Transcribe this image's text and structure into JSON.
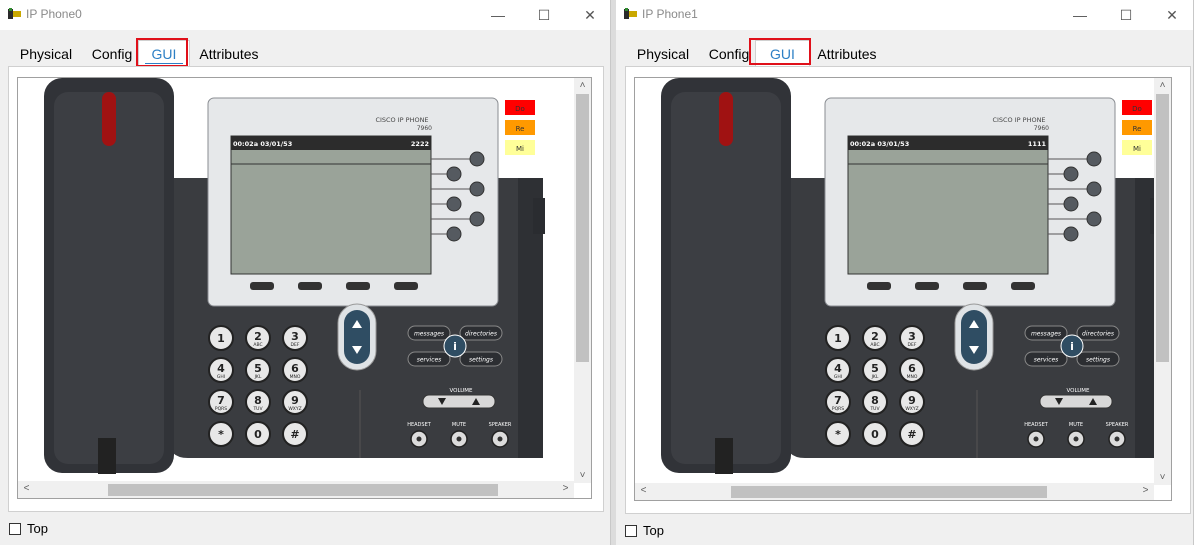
{
  "windows": [
    {
      "title": "IP Phone0",
      "tabs": [
        "Physical",
        "Config",
        "GUI",
        "Attributes"
      ],
      "active_tab": "GUI",
      "phone": {
        "brand": "CISCO IP PHONE",
        "model": "7960",
        "screen_time": "00:02a 03/01/53",
        "screen_number": "2222",
        "status_labels": [
          "Do",
          "Re",
          "Mi"
        ],
        "keys": [
          [
            "1",
            ""
          ],
          [
            "2",
            "ABC"
          ],
          [
            "3",
            "DEF"
          ],
          [
            "4",
            "GHI"
          ],
          [
            "5",
            "JKL"
          ],
          [
            "6",
            "MNO"
          ],
          [
            "7",
            "PQRS"
          ],
          [
            "8",
            "TUV"
          ],
          [
            "9",
            "WXYZ"
          ],
          [
            "*",
            ""
          ],
          [
            "0",
            ""
          ],
          [
            "#",
            ""
          ]
        ],
        "func_buttons": [
          "messages",
          "directories",
          "services",
          "settings"
        ],
        "volume_label": "VOLUME",
        "bottom_labels": [
          "HEADSET",
          "MUTE",
          "SPEAKER"
        ]
      },
      "top_label": "Top"
    },
    {
      "title": "IP Phone1",
      "tabs": [
        "Physical",
        "Config",
        "GUI",
        "Attributes"
      ],
      "active_tab": "GUI",
      "phone": {
        "brand": "CISCO IP PHONE",
        "model": "7960",
        "screen_time": "00:02a 03/01/53",
        "screen_number": "1111",
        "status_labels": [
          "Do",
          "Re",
          "Mi"
        ],
        "keys": [
          [
            "1",
            ""
          ],
          [
            "2",
            "ABC"
          ],
          [
            "3",
            "DEF"
          ],
          [
            "4",
            "GHI"
          ],
          [
            "5",
            "JKL"
          ],
          [
            "6",
            "MNO"
          ],
          [
            "7",
            "PQRS"
          ],
          [
            "8",
            "TUV"
          ],
          [
            "9",
            "WXYZ"
          ],
          [
            "*",
            ""
          ],
          [
            "0",
            ""
          ],
          [
            "#",
            ""
          ]
        ],
        "func_buttons": [
          "messages",
          "directories",
          "services",
          "settings"
        ],
        "volume_label": "VOLUME",
        "bottom_labels": [
          "HEADSET",
          "MUTE",
          "SPEAKER"
        ]
      },
      "top_label": "Top"
    }
  ],
  "window_controls": {
    "minimize": "—",
    "maximize": "☐",
    "close": "✕"
  },
  "colors": {
    "status_do": "#ff0000",
    "status_re": "#ff9900",
    "status_mi": "#ffff99",
    "active_tab_text": "#2c7fc5",
    "highlight": "#e0101a",
    "lcd": "#9aa399"
  }
}
